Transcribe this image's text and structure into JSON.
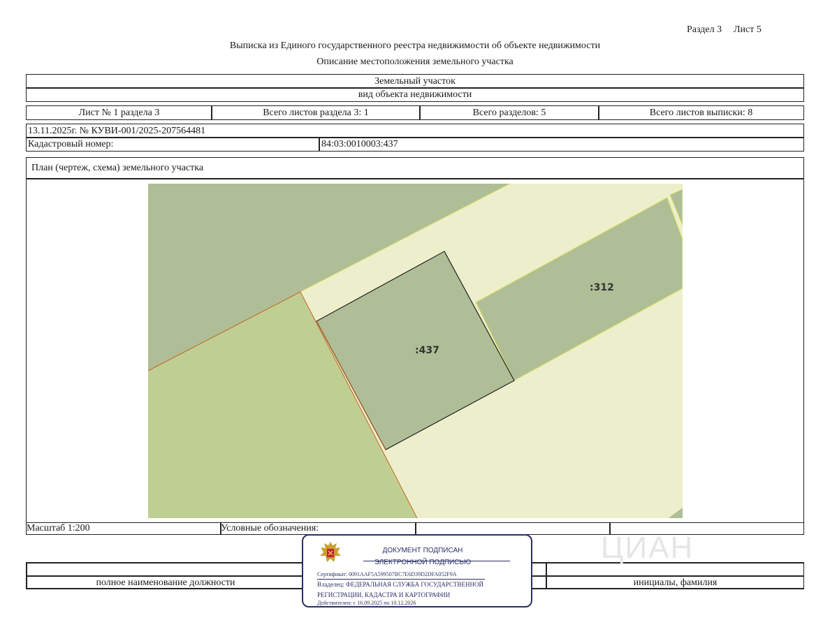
{
  "header": {
    "section_label": "Раздел 3",
    "sheet_label": "Лист 5",
    "title": "Выписка из Единого государственного реестра недвижимости об объекте недвижимости",
    "subtitle": "Описание местоположения земельного участка"
  },
  "object": {
    "type_value": "Земельный участок",
    "type_caption": "вид объекта недвижимости"
  },
  "sheets": {
    "sheet_no": "Лист № 1 раздела 3",
    "total_section_sheets": "Всего листов раздела 3: 1",
    "total_sections": "Всего разделов: 5",
    "total_extract_sheets": "Всего листов выписки: 8"
  },
  "record": {
    "date_number": "13.11.2025г. № КУВИ-001/2025-207564481",
    "cadastral_label": "Кадастровый номер:",
    "cadastral_value": "84:03:0010003:437"
  },
  "plan": {
    "title": "План (чертеж, схема) земельного участка",
    "parcel_main_label": ":437",
    "parcel_neighbor_label": ":312",
    "colors": {
      "dark_parcel": "#afbe96",
      "light_green_parcel": "#bfcf94",
      "background_parcel": "#edefcc",
      "border_orange": "#c8641e"
    }
  },
  "footer": {
    "scale": "Масштаб 1:200",
    "legend_label": "Условные обозначения:",
    "position_caption": "полное наименование должности",
    "name_caption": "инициалы, фамилия"
  },
  "stamp": {
    "emblem_icon": "eagle-emblem-icon",
    "line1": "ДОКУМЕНТ ПОДПИСАН",
    "line2": "ЭЛЕКТРОННОЙ ПОДПИСЬЮ",
    "certificate": "Сертификат: 0091AAF5A599507BC7E6D39D2DFA052F9A",
    "owner_line1": "Владелец: ФЕДЕРАЛЬНАЯ СЛУЖБА ГОСУДАРСТВЕННОЙ",
    "owner_line2": "РЕГИСТРАЦИИ, КАДАСТРА И КАРТОГРАФИИ",
    "validity": "Действителен: с 16.09.2025 по 10.12.2026"
  },
  "watermark": "ЦИАН"
}
